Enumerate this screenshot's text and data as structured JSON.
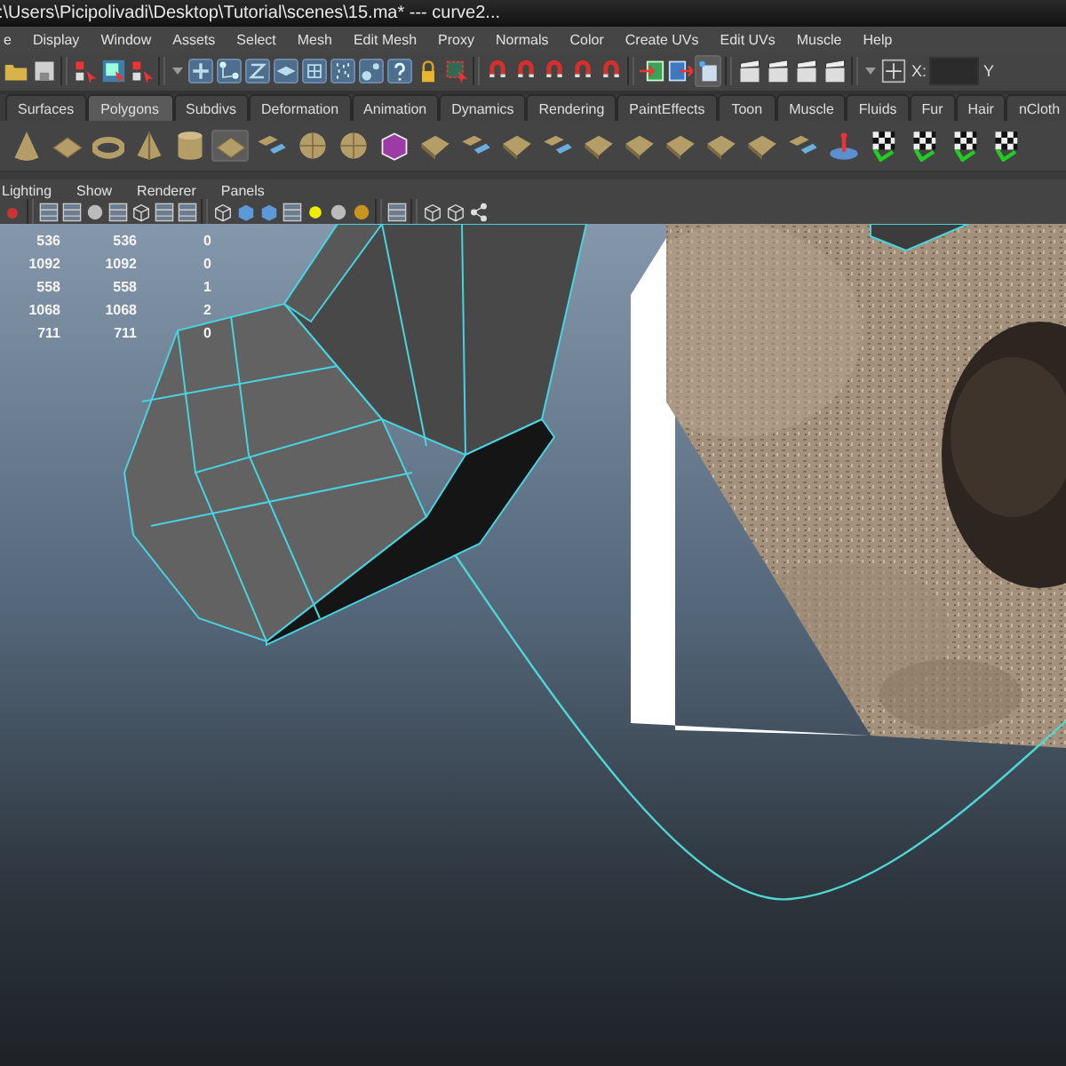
{
  "window": {
    "title": ":\\Users\\Picipolivadi\\Desktop\\Tutorial\\scenes\\15.ma*   ---   curve2..."
  },
  "menu_bar": [
    "e",
    "Display",
    "Window",
    "Assets",
    "Select",
    "Mesh",
    "Edit Mesh",
    "Proxy",
    "Normals",
    "Color",
    "Create UVs",
    "Edit UVs",
    "Muscle",
    "Help"
  ],
  "status_line": {
    "x_label": "X:",
    "y_label": "Y"
  },
  "shelf": {
    "tabs": [
      {
        "label": "Surfaces",
        "selected": false
      },
      {
        "label": "Polygons",
        "selected": true
      },
      {
        "label": "Subdivs",
        "selected": false
      },
      {
        "label": "Deformation",
        "selected": false
      },
      {
        "label": "Animation",
        "selected": false
      },
      {
        "label": "Dynamics",
        "selected": false
      },
      {
        "label": "Rendering",
        "selected": false
      },
      {
        "label": "PaintEffects",
        "selected": false
      },
      {
        "label": "Toon",
        "selected": false
      },
      {
        "label": "Muscle",
        "selected": false
      },
      {
        "label": "Fluids",
        "selected": false
      },
      {
        "label": "Fur",
        "selected": false
      },
      {
        "label": "Hair",
        "selected": false
      },
      {
        "label": "nCloth",
        "selected": false
      }
    ]
  },
  "panel": {
    "menus": [
      "Lighting",
      "Show",
      "Renderer",
      "Panels"
    ],
    "heads_up_display": {
      "rows": [
        [
          "536",
          "536",
          "0"
        ],
        [
          "1092",
          "1092",
          "0"
        ],
        [
          "558",
          "558",
          "1"
        ],
        [
          "1068",
          "1068",
          "2"
        ],
        [
          "711",
          "711",
          "0"
        ]
      ]
    }
  }
}
